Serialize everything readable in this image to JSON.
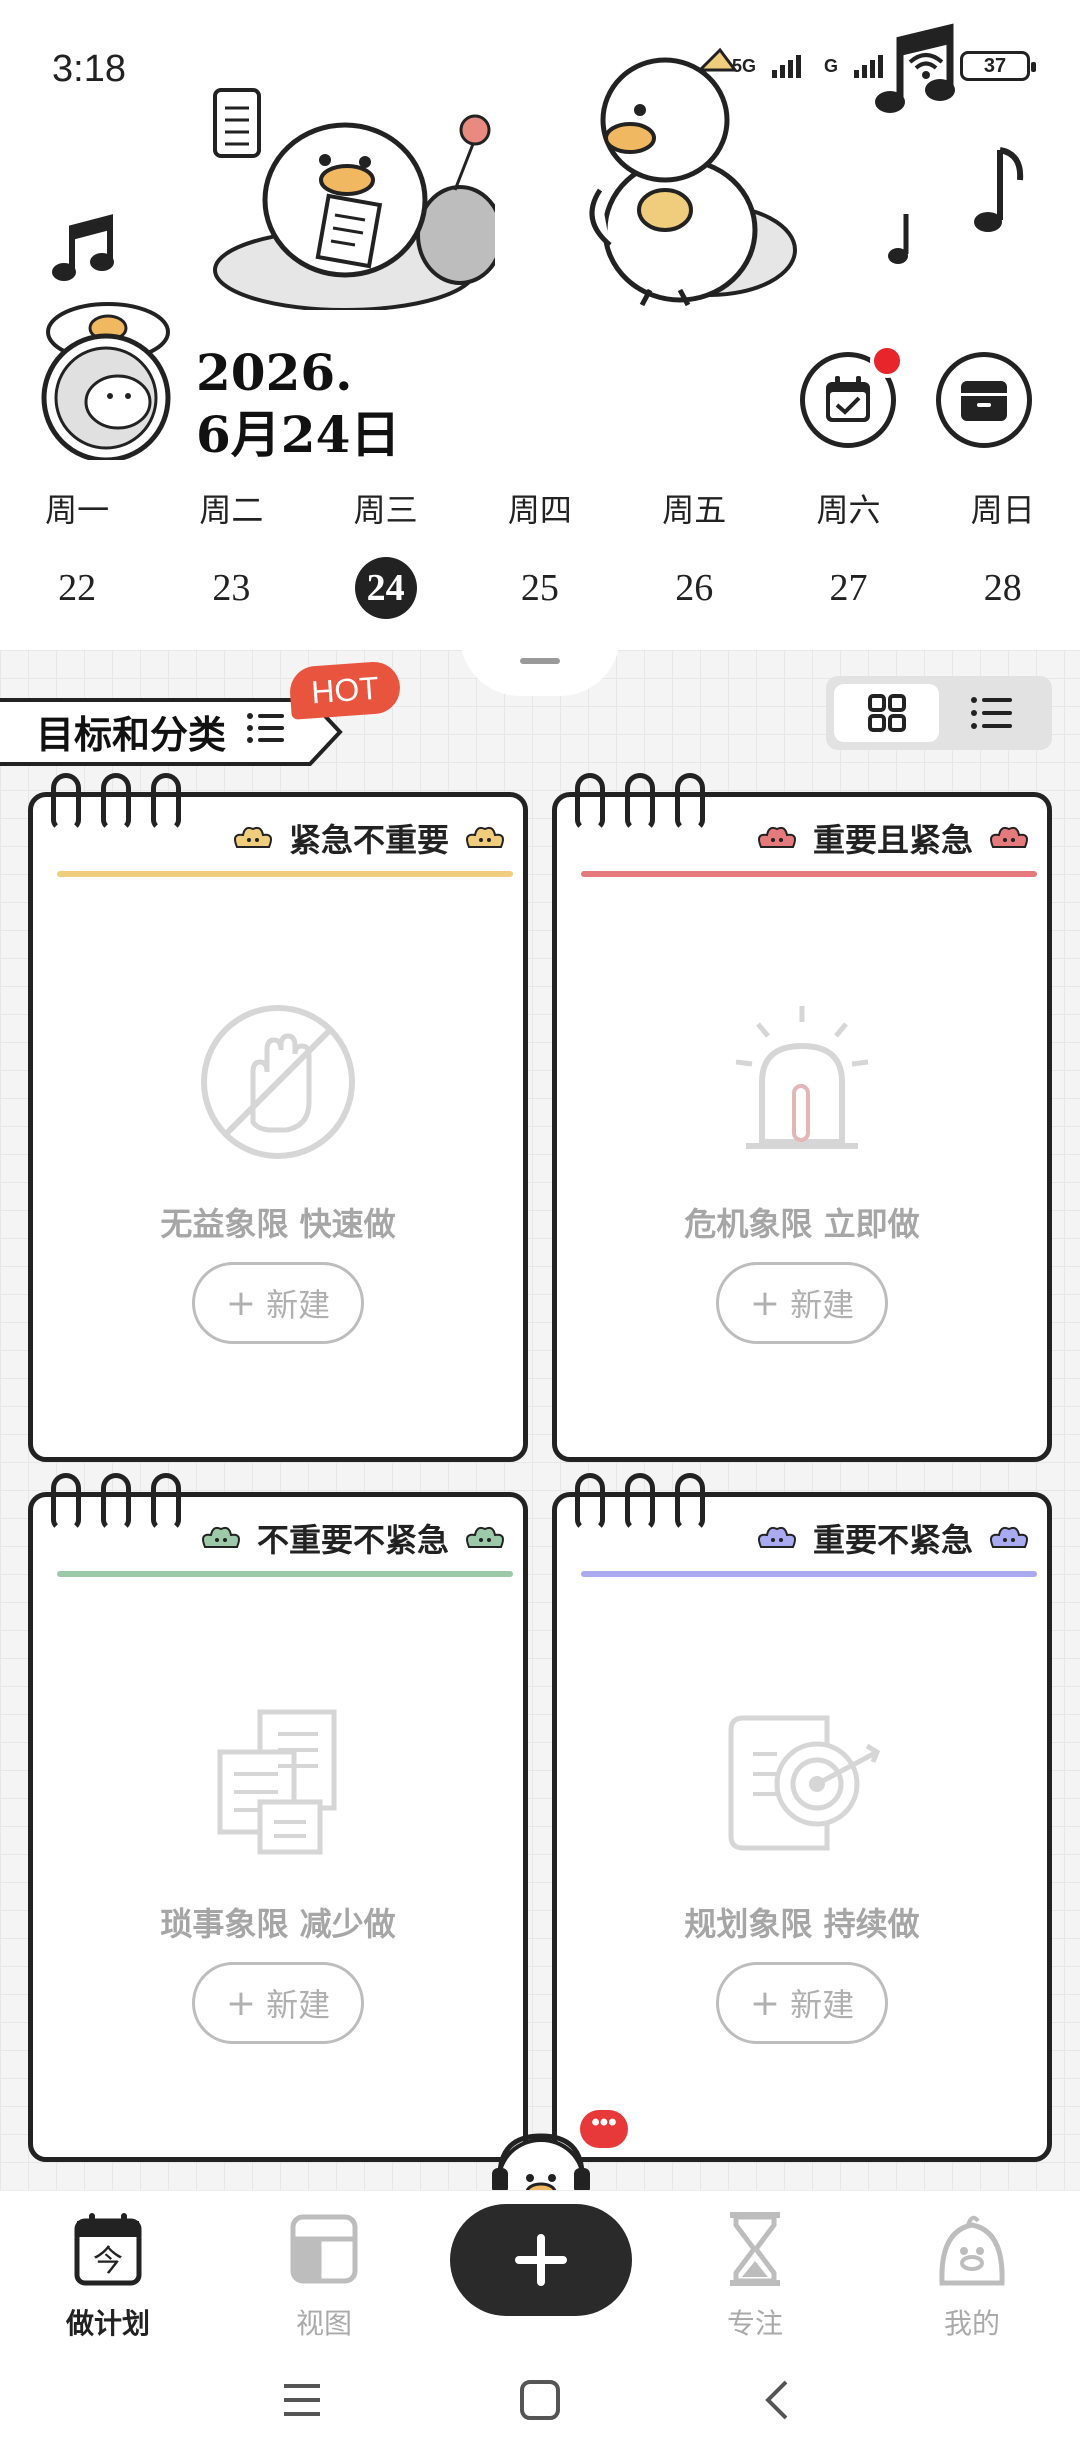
{
  "status_bar": {
    "time": "3:18",
    "network_5g": "5G",
    "network_g": "G",
    "battery": "37"
  },
  "header": {
    "date_year": "2026.",
    "date_day": "6月24日"
  },
  "week": [
    {
      "name": "周一",
      "num": "22",
      "active": false
    },
    {
      "name": "周二",
      "num": "23",
      "active": false
    },
    {
      "name": "周三",
      "num": "24",
      "active": true
    },
    {
      "name": "周四",
      "num": "25",
      "active": false
    },
    {
      "name": "周五",
      "num": "26",
      "active": false
    },
    {
      "name": "周六",
      "num": "27",
      "active": false
    },
    {
      "name": "周日",
      "num": "28",
      "active": false
    }
  ],
  "goals": {
    "label": "目标和分类",
    "hot_badge": "HOT"
  },
  "quadrants": [
    {
      "title": "紧急不重要",
      "subtitle": "无益象限 快速做",
      "new_label": "新建",
      "accent": "#f0cd7c",
      "icon": "stop-hand-icon"
    },
    {
      "title": "重要且紧急",
      "subtitle": "危机象限 立即做",
      "new_label": "新建",
      "accent": "#e57a7c",
      "icon": "siren-icon"
    },
    {
      "title": "不重要不紧急",
      "subtitle": "琐事象限 减少做",
      "new_label": "新建",
      "accent": "#9cc9a8",
      "icon": "documents-icon"
    },
    {
      "title": "重要不紧急",
      "subtitle": "规划象限 持续做",
      "new_label": "新建",
      "accent": "#a9aaf0",
      "icon": "target-scroll-icon"
    }
  ],
  "bottom_nav": {
    "plan_label": "做计划",
    "plan_icon_char": "今",
    "view_label": "视图",
    "focus_label": "专注",
    "mine_label": "我的",
    "chat_bubble": "•••"
  }
}
